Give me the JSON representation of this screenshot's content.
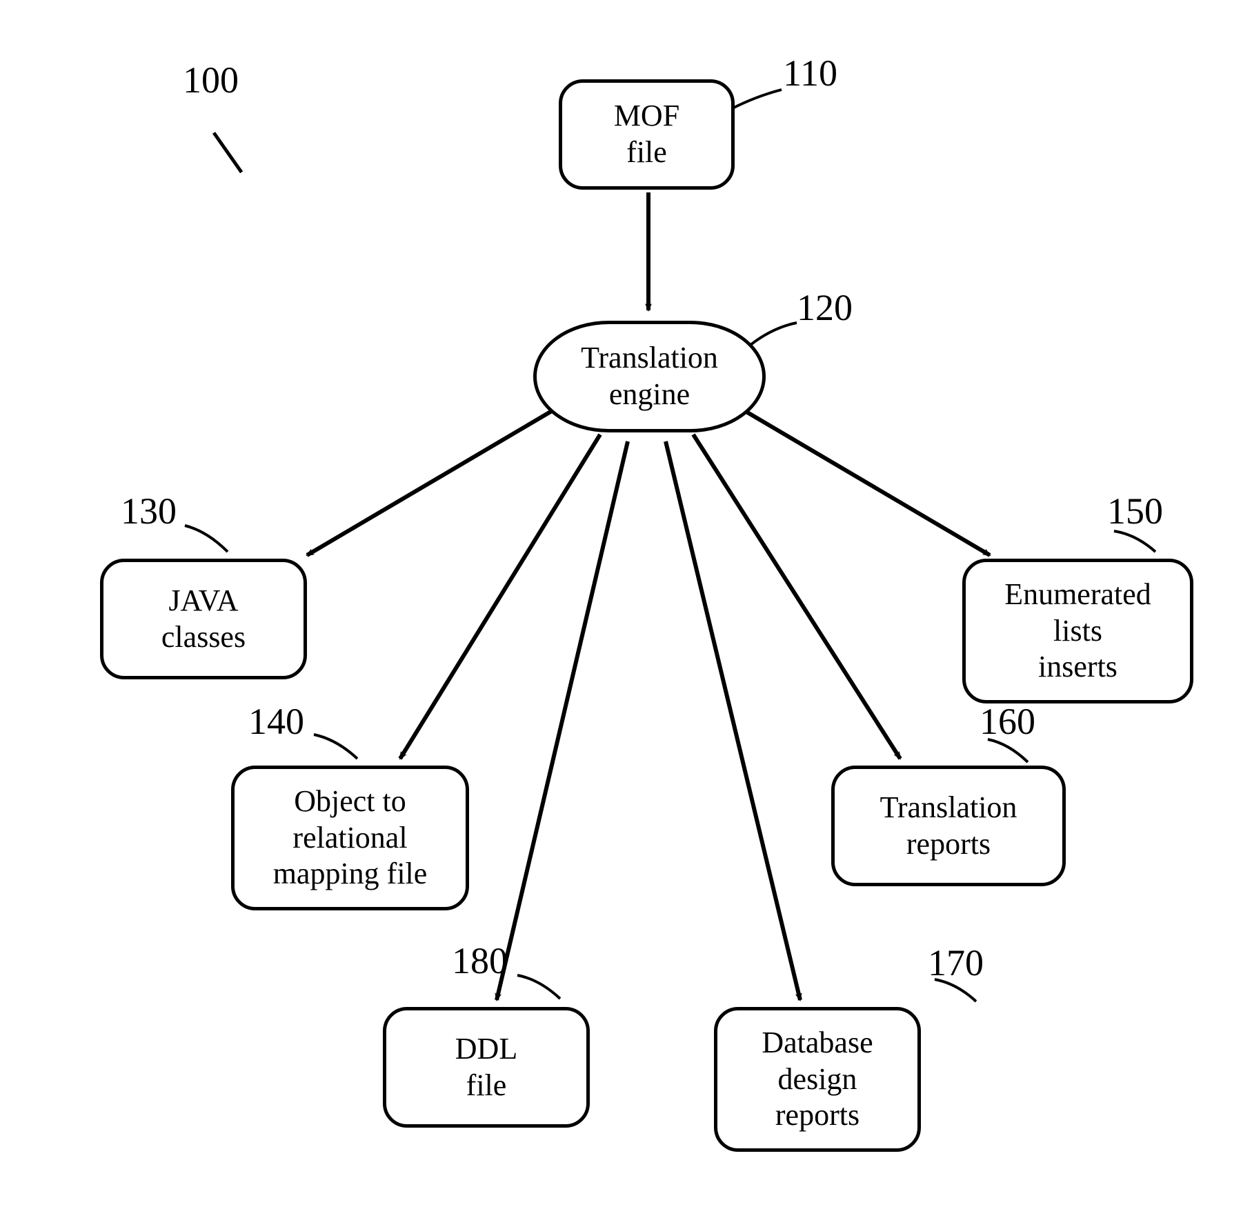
{
  "refs": {
    "system": "100",
    "mof": "110",
    "engine": "120",
    "java": "130",
    "mapping": "140",
    "enum": "150",
    "reports": "160",
    "dbdesign": "170",
    "ddl": "180"
  },
  "labels": {
    "mof": "MOF\nfile",
    "engine": "Translation\nengine",
    "java": "JAVA\nclasses",
    "mapping": "Object to\nrelational\nmapping file",
    "enum": "Enumerated\nlists\ninserts",
    "reports": "Translation\nreports",
    "dbdesign": "Database\ndesign\nreports",
    "ddl": "DDL\nfile"
  }
}
